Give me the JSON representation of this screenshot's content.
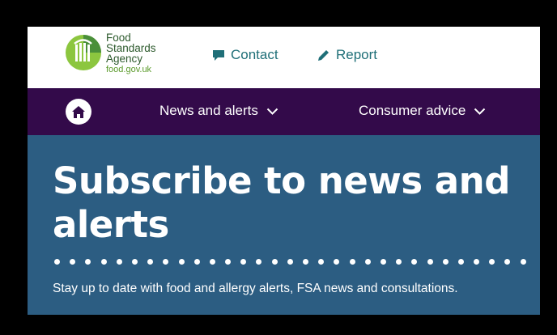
{
  "header": {
    "logo": {
      "line1": "Food",
      "line2": "Standards",
      "line3": "Agency",
      "url": "food.gov.uk",
      "icon": "fsa-logo-icon"
    },
    "links": [
      {
        "label": "Contact",
        "icon": "speech-bubble-icon"
      },
      {
        "label": "Report",
        "icon": "pencil-icon"
      }
    ]
  },
  "nav": {
    "home_icon": "home-icon",
    "items": [
      {
        "label": "News and alerts",
        "icon": "chevron-down-icon"
      },
      {
        "label": "Consumer advice",
        "icon": "chevron-down-icon"
      }
    ]
  },
  "hero": {
    "title": "Subscribe to news and alerts",
    "subtitle": "Stay up to date with food and allergy alerts, FSA news and consultations."
  },
  "colors": {
    "nav_bg": "#330a4a",
    "hero_bg": "#2c5d82",
    "link": "#1f6f78",
    "logo_green": "#5a9a2a"
  }
}
